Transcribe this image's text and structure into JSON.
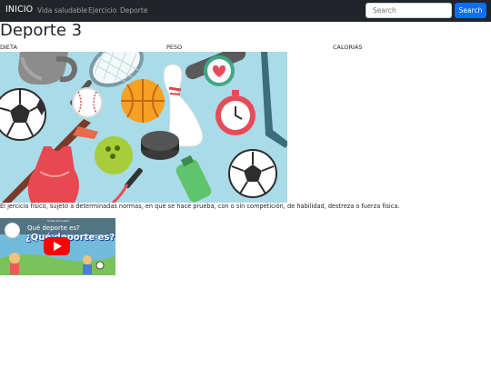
{
  "navbar": {
    "brand": "INICIO",
    "links": [
      "Vida saludable",
      "Ejercicio",
      "Deporte"
    ],
    "search_placeholder": "Search",
    "search_button": "Search"
  },
  "page": {
    "title": "Deporte 3",
    "columns": [
      "DIETA",
      "PESO",
      "CALORIAS"
    ]
  },
  "description": "El jercicio físico, sujeto a determinadas normas, en que se hace prueba, con o sin competición, de habilidad, destreza o fuerza física.",
  "video": {
    "title": "Qué deporte es?",
    "overlay_title": "¿Qué deporte es?",
    "channel_text": "Smile and Learn"
  },
  "colors": {
    "navbar_bg": "#212529",
    "accent": "#0d6efd",
    "hero_bg": "#a9dbe8",
    "youtube_red": "#ff0000"
  },
  "icons": {
    "hero": [
      "kettlebell-icon",
      "tennis-racket-icon",
      "heart-rate-watch-icon",
      "soccer-ball-icon",
      "baseball-icon",
      "basketball-icon",
      "bowling-pin-icon",
      "stopwatch-icon",
      "hockey-stick-icon",
      "swimsuit-icon",
      "bowling-ball-icon",
      "hockey-puck-icon",
      "jump-rope-icon",
      "water-bottle-icon"
    ],
    "video": [
      "channel-logo-icon",
      "play-button-icon"
    ]
  }
}
